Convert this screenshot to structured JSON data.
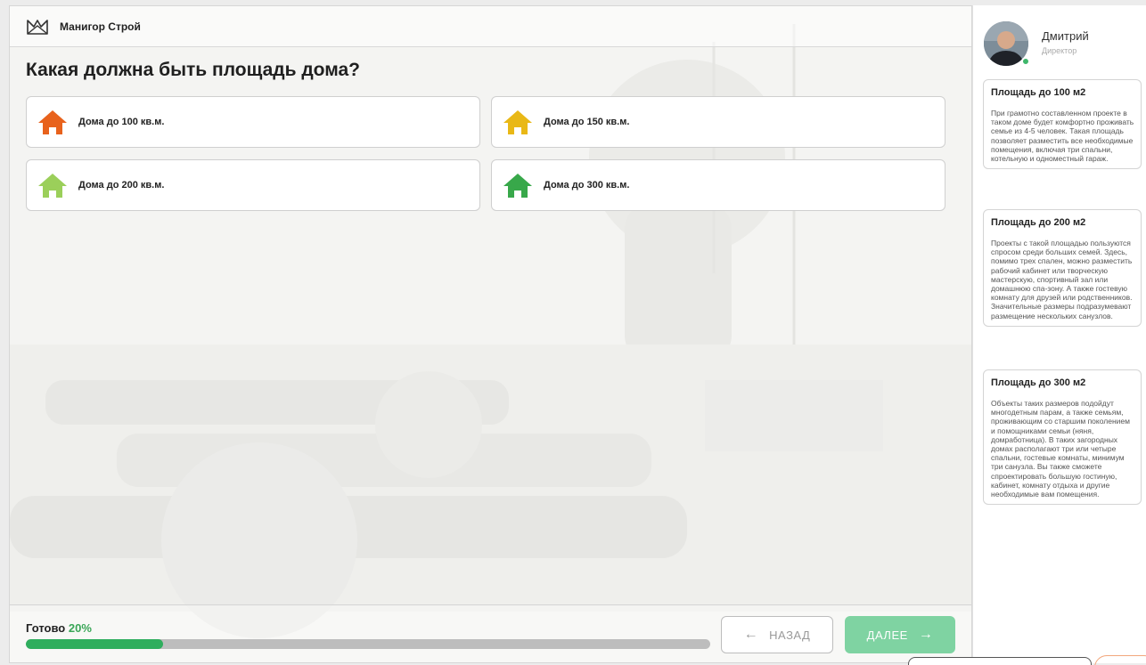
{
  "header": {
    "brand": "Манигор Строй"
  },
  "question": "Какая должна быть площадь дома?",
  "options": [
    {
      "label": "Дома до 100 кв.м.",
      "color": "#e8621c"
    },
    {
      "label": "Дома до 150 кв.м.",
      "color": "#e9b816"
    },
    {
      "label": "Дома до 200 кв.м.",
      "color": "#9bcf5a"
    },
    {
      "label": "Дома до 300 кв.м.",
      "color": "#38a84a"
    }
  ],
  "footer": {
    "ready_label": "Готово",
    "ready_percent": "20%",
    "progress": 0.2,
    "back_label": "НАЗАД",
    "next_label": "ДАЛЕЕ"
  },
  "manager": {
    "name": "Дмитрий",
    "role": "Директор"
  },
  "cards": [
    {
      "title": "Площадь до 100 м2",
      "text": "При грамотно составленном проекте в таком доме будет комфортно проживать семье из 4-5 человек. Такая площадь позволяет разместить все необходимые помещения, включая три спальни, котельную и одноместный гараж."
    },
    {
      "title": "Площадь до 200 м2",
      "text": "Проекты с такой площадью пользуются спросом среди больших семей. Здесь, помимо трех спален, можно разместить рабочий кабинет или творческую мастерскую, спортивный зал или домашнюю спа-зону. А также гостевую комнату для друзей или родственников. Значительные размеры подразумевают размещение нескольких санузлов."
    },
    {
      "title": "Площадь до 300 м2",
      "text": "Объекты таких размеров подойдут многодетным парам, а также семьям, проживающим со старшим поколением и помощниками семьи (няня, домработница). В таких загородных домах располагают три или четыре спальни, гостевые комнаты, минимум три санузла. Вы также сможете спроектировать большую гостиную, кабинет, комнату отдыха и другие необходимые вам помещения."
    }
  ],
  "icons": {
    "logo": "crown-logo-icon",
    "option": "house-icon",
    "back": "arrow-left-icon",
    "next": "arrow-right-icon"
  },
  "colors": {
    "accent": "#2fae5d",
    "next_button": "#7fd3a2",
    "percent_text": "#3aa657"
  }
}
